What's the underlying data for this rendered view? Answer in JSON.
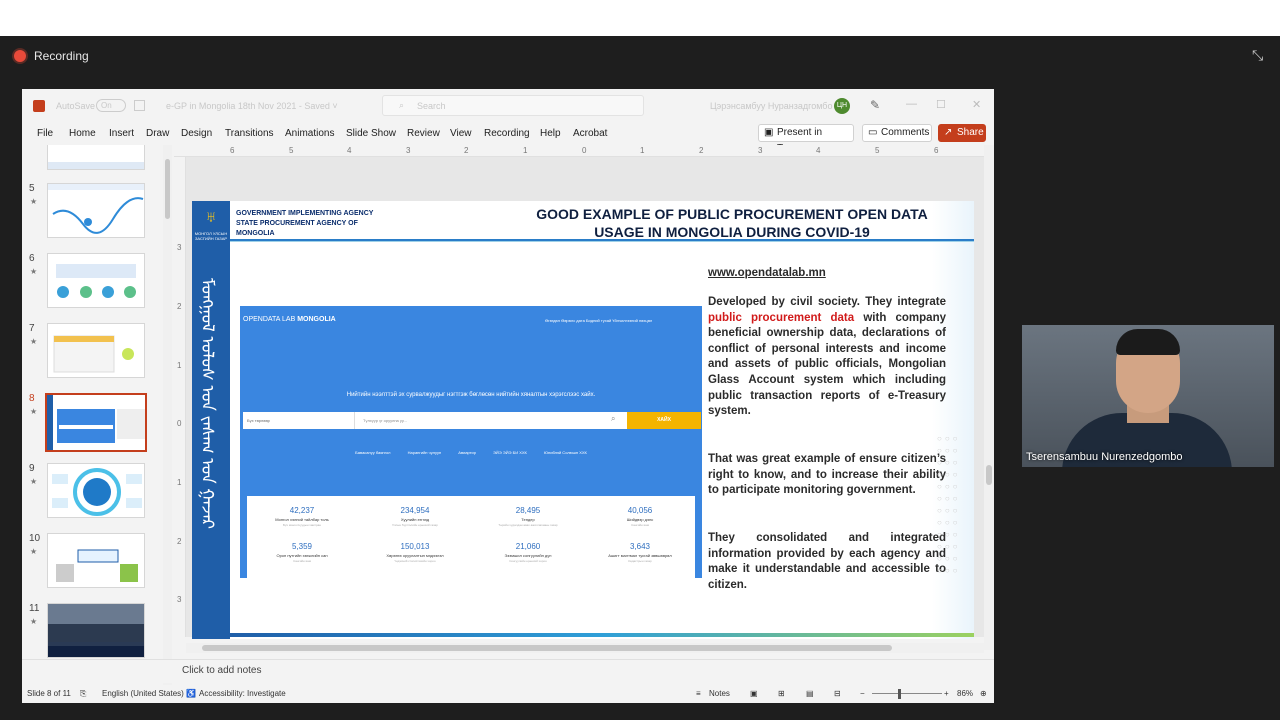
{
  "recording": {
    "label": "Recording"
  },
  "app": {
    "autosave": "AutoSave",
    "toggle": "On",
    "doc_title": "e-GP in Mongolia 18th Nov 2021 - Saved ˅",
    "search_placeholder": "Search",
    "user": "Цэрэнсамбуу Нуранзадгомбо",
    "user_initials": "ЦН",
    "menu": [
      "File",
      "Home",
      "Insert",
      "Draw",
      "Design",
      "Transitions",
      "Animations",
      "Slide Show",
      "Review",
      "View",
      "Recording",
      "Help",
      "Acrobat"
    ],
    "present": "Present in Teams",
    "comments": "Comments",
    "share": "Share"
  },
  "ruler": {
    "h": [
      "6",
      "5",
      "4",
      "3",
      "2",
      "1",
      "0",
      "1",
      "2",
      "3",
      "4",
      "5",
      "6"
    ],
    "v": [
      "3",
      "2",
      "1",
      "0",
      "1",
      "2",
      "3"
    ]
  },
  "thumbnails": [
    {
      "num": "",
      "star": ""
    },
    {
      "num": "5",
      "star": "★"
    },
    {
      "num": "6",
      "star": "★"
    },
    {
      "num": "7",
      "star": "★"
    },
    {
      "num": "8",
      "star": "★"
    },
    {
      "num": "9",
      "star": "★"
    },
    {
      "num": "10",
      "star": "★"
    },
    {
      "num": "11",
      "star": "★"
    }
  ],
  "slide": {
    "agency": [
      "GOVERNMENT IMPLEMENTING AGENCY",
      "STATE PROCUREMENT AGENCY OF",
      "MONGOLIA"
    ],
    "logo_text": "МОНГОЛ УЛСЫН ЗАСГИЙН ГАЗАР",
    "mongol_script": "ᠮᠣᠩᠭᠣᠯ ᠤᠯᠤᠰ ᠤᠨ ᠵᠠᠰᠠᠭ ᠤᠨ ᠭᠠᠵᠠᠷ",
    "title_line1": "GOOD EXAMPLE OF PUBLIC PROCUREMENT OPEN DATA",
    "title_line2": "USAGE IN MONGOLIA DURING COVID-19",
    "url": "www.opendatalab.mn",
    "p1_a": "Developed by civil society. They integrate",
    "p1_red": "public procurement data",
    "p1_b": "with company beneficial ownership data, declarations of conflict of personal interests and income and assets of public officials, Mongolian Glass Account system which including public transaction reports of e-Treasury system.",
    "p2": "That was great example of ensure citizen’s right to know, and to increase their ability to participate monitoring government.",
    "p3": "They consolidated and integrated information provided by each agency and make it understandable and accessible to citizen.",
    "web": {
      "brand_a": "OPENDATA LAB",
      "brand_b": "MONGOLIA",
      "nav": "Өгөгдөл   Өөрөлс дата   Бидний тухай   Үйлчилгээний нөхцөл",
      "tagline": "Нийтийн нээлттэй эх сурвалжуудыг нэгтгэж бөглөсөн нийтийн хяналтын хэрэгслээс хайх.",
      "select": "Бүх төрлөөр",
      "input": "Түлхүүр үг оруулна уу...",
      "button": "ХАЙХ",
      "links": [
        "Бавасануу баянгол",
        "Нарангийн чулуун",
        "Авиартир",
        "ЭЙЭ ЭЙЭ БИ ХХК",
        "Юниблэй Солюшн ХХК"
      ],
      "stats": [
        {
          "v": "42,237",
          "l": "Монгол хэлний тайлбар толь",
          "s": "Бүх монголчуудын хамтран"
        },
        {
          "v": "234,954",
          "l": "Хуулийн этгээд",
          "s": "Улсын бүртгэлийн ерөнхий газар"
        },
        {
          "v": "28,495",
          "l": "Тендер",
          "s": "Төрийн худалдан авах ажиллагааны газар"
        },
        {
          "v": "40,056",
          "l": "Шийдвэр дэнс",
          "s": "Сангийн яам"
        },
        {
          "v": "5,359",
          "l": "Орон нутгийн хөгжлийн сан",
          "s": "Сангийн яам"
        },
        {
          "v": "150,013",
          "l": "Хөрөнгө оруулалтын мэдээлэл",
          "s": "Үндэсний статистикийн хороо"
        },
        {
          "v": "21,060",
          "l": "Эзэмшил сонгуулийн дүн",
          "s": "Сонгуулийн ерөнхий хороо"
        },
        {
          "v": "3,643",
          "l": "Ашигт малтмал тусгай зөвшөөрөл",
          "s": "Кадастрын газар"
        }
      ]
    }
  },
  "notes": "Click to add notes",
  "status": {
    "slide": "Slide 8 of 11",
    "lang": "English (United States)",
    "access": "Accessibility: Investigate",
    "notes_btn": "Notes",
    "zoom": "86%"
  },
  "camera": {
    "name": "Tserensambuu Nurenzedgombo"
  }
}
